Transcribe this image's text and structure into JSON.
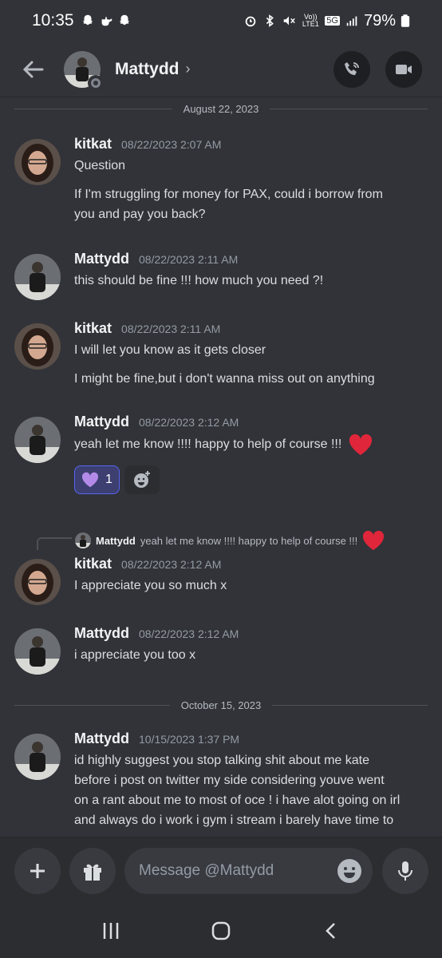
{
  "status_bar": {
    "time": "10:35",
    "left_icons": [
      "snapchat-icon",
      "teapot-icon",
      "snapchat-icon"
    ],
    "right_icons": [
      "alarm-icon",
      "bluetooth-icon",
      "mute-icon",
      "volte-icon",
      "5g-icon",
      "signal-icon"
    ],
    "volte_label": "Vo)) LTE1",
    "network": "5G",
    "battery": "79%"
  },
  "header": {
    "name": "Mattydd",
    "chevron": "›",
    "back_icon": "arrow-left-icon",
    "call_icon": "phone-call-icon",
    "video_icon": "video-camera-icon"
  },
  "dividers": {
    "first": "August 22, 2023",
    "second": "October 15, 2023"
  },
  "messages": [
    {
      "author": "kitkat",
      "timestamp": "08/22/2023 2:07 AM",
      "lines": [
        "Question",
        "If I'm struggling for money for PAX, could i borrow from",
        "you and pay you back?"
      ]
    },
    {
      "author": "Mattydd",
      "timestamp": "08/22/2023 2:11 AM",
      "lines": [
        "this should be fine !!! how much you need ?!"
      ]
    },
    {
      "author": "kitkat",
      "timestamp": "08/22/2023 2:11 AM",
      "lines": [
        "I will let you know as it gets closer",
        "I might be fine,but i don't wanna miss out on anything"
      ]
    },
    {
      "author": "Mattydd",
      "timestamp": "08/22/2023 2:12 AM",
      "lines": [
        "yeah let me know !!!! happy to help of course !!!"
      ],
      "reaction": {
        "emoji": "purple-heart-icon",
        "count": "1"
      }
    },
    {
      "author": "kitkat",
      "timestamp": "08/22/2023 2:12 AM",
      "lines": [
        "I appreciate you so much x"
      ],
      "reply_to": {
        "author": "Mattydd",
        "text": "yeah let me know !!!! happy to help of course !!!"
      }
    },
    {
      "author": "Mattydd",
      "timestamp": "08/22/2023 2:12 AM",
      "lines": [
        "i appreciate you too x"
      ]
    },
    {
      "author": "Mattydd",
      "timestamp": "10/15/2023 1:37 PM",
      "lines": [
        "id highly suggest you stop talking shit about me kate",
        "before i post on twitter my side considering youve went",
        "on a rant about me to most of oce ! i have alot going on irl",
        "and always do i work i gym i stream i barely have time to"
      ]
    }
  ],
  "composer": {
    "placeholder": "Message @Mattydd",
    "plus_icon": "plus-icon",
    "gift_icon": "gift-icon",
    "emoji_icon": "emoji-icon",
    "mic_icon": "microphone-icon"
  },
  "nav": [
    "recent-apps-icon",
    "home-icon",
    "back-icon"
  ],
  "colors": {
    "background": "#313338",
    "accent": "#5865f2",
    "heart": "#e0263a"
  }
}
